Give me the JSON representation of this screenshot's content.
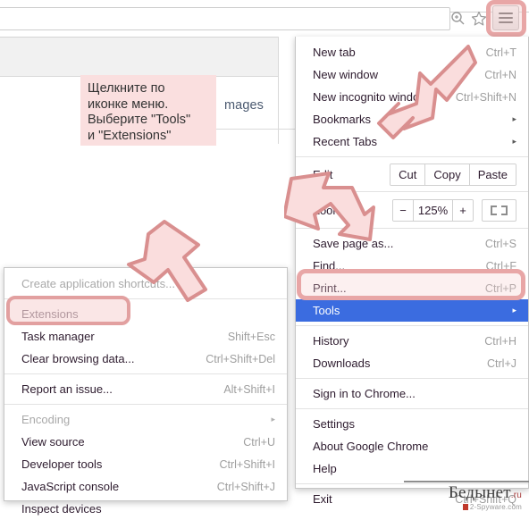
{
  "browser": {
    "omnibox_value": "",
    "page_link_fragment": "mages",
    "toolbar_icons": {
      "search": "search-icon",
      "bookmark": "star-icon",
      "menu": "hamburger-menu-icon"
    }
  },
  "callout": {
    "line1": "Щелкните по",
    "line2": "иконке меню.",
    "line3": "Выберите \"Tools\"",
    "line4": "и \"Extensions\""
  },
  "main_menu": {
    "items": [
      {
        "label": "New tab",
        "accel": "Ctrl+T"
      },
      {
        "label": "New window",
        "accel": "Ctrl+N"
      },
      {
        "label": "New incognito window",
        "accel": "Ctrl+Shift+N"
      },
      {
        "label": "Bookmarks",
        "accel": "",
        "caret": "▸"
      },
      {
        "label": "Recent Tabs",
        "accel": "",
        "caret": "▸"
      }
    ],
    "edit_row": {
      "label": "Edit",
      "buttons": [
        "Cut",
        "Copy",
        "Paste"
      ]
    },
    "zoom_row": {
      "label": "Zoom",
      "minus": "−",
      "value": "125%",
      "plus": "+",
      "fullscreen": "fullscreen-icon"
    },
    "items2": [
      {
        "label": "Save page as...",
        "accel": "Ctrl+S"
      },
      {
        "label": "Find...",
        "accel": "Ctrl+F"
      },
      {
        "label": "Print...",
        "accel": "Ctrl+P"
      }
    ],
    "tools": {
      "label": "Tools",
      "accel": "",
      "caret": "▸",
      "selected": true
    },
    "items3": [
      {
        "label": "History",
        "accel": "Ctrl+H"
      },
      {
        "label": "Downloads",
        "accel": "Ctrl+J"
      }
    ],
    "signin": {
      "label": "Sign in to Chrome...",
      "accel": ""
    },
    "items4": [
      {
        "label": "Settings",
        "accel": ""
      },
      {
        "label": "About Google Chrome",
        "accel": ""
      },
      {
        "label": "Help",
        "accel": ""
      }
    ],
    "exit": {
      "label": "Exit",
      "accel": "Ctrl+Shift+Q"
    }
  },
  "tools_submenu": {
    "group1": [
      {
        "label": "Create application shortcuts...",
        "accel": "",
        "disabled": true
      }
    ],
    "group2": [
      {
        "label": "Extensions",
        "accel": "",
        "highlighted": true
      },
      {
        "label": "Task manager",
        "accel": "Shift+Esc"
      },
      {
        "label": "Clear browsing data...",
        "accel": "Ctrl+Shift+Del"
      }
    ],
    "group3": [
      {
        "label": "Report an issue...",
        "accel": "Alt+Shift+I"
      }
    ],
    "group4": [
      {
        "label": "Encoding",
        "accel": "",
        "caret": "▸",
        "disabled": true
      },
      {
        "label": "View source",
        "accel": "Ctrl+U"
      },
      {
        "label": "Developer tools",
        "accel": "Ctrl+Shift+I"
      },
      {
        "label": "JavaScript console",
        "accel": "Ctrl+Shift+J"
      },
      {
        "label": "Inspect devices",
        "accel": ""
      }
    ]
  },
  "watermark": {
    "name": "Бедынет",
    "tld": ".ru",
    "sub": "2-Spyware.com"
  },
  "colors": {
    "highlight_ring": "#e8a6a6",
    "callout_bg": "#fadfdf",
    "selected_row": "#3b6ce0",
    "arrow_fill": "#fadddd",
    "arrow_stroke": "#d98f8f"
  }
}
